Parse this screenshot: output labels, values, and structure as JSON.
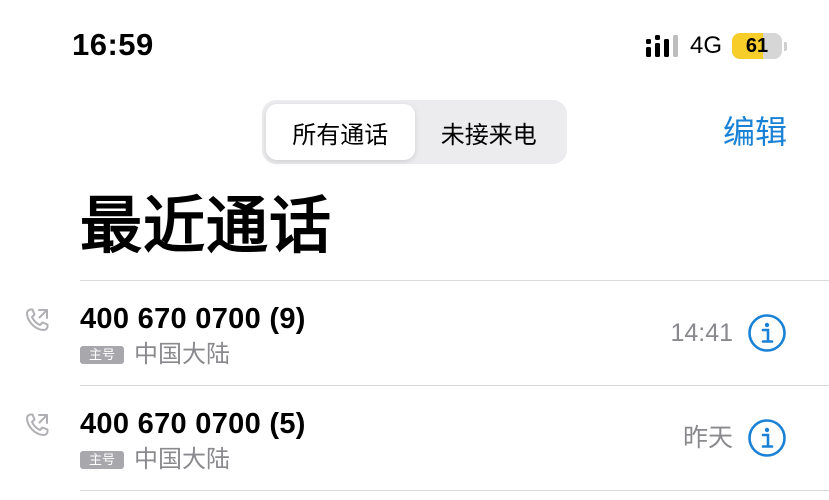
{
  "status_bar": {
    "time": "16:59",
    "network": "4G",
    "battery_level": "61",
    "battery_fraction": 0.61,
    "signal_icon": "signal-bars-icon",
    "colors": {
      "battery_fill": "#f7cd2a"
    }
  },
  "header": {
    "segments": [
      {
        "label": "所有通话",
        "selected": true
      },
      {
        "label": "未接来电",
        "selected": false
      }
    ],
    "edit_label": "编辑",
    "title": "最近通话"
  },
  "calls": [
    {
      "number": "400 670 0700 (9)",
      "sim_label": "主号",
      "location": "中国大陆",
      "time": "14:41",
      "icon": "phone-outgoing-icon"
    },
    {
      "number": "400 670 0700 (5)",
      "sim_label": "主号",
      "location": "中国大陆",
      "time": "昨天",
      "icon": "phone-outgoing-icon"
    }
  ],
  "colors": {
    "accent": "#1a82d6",
    "secondary_text": "#8a8a8e"
  }
}
